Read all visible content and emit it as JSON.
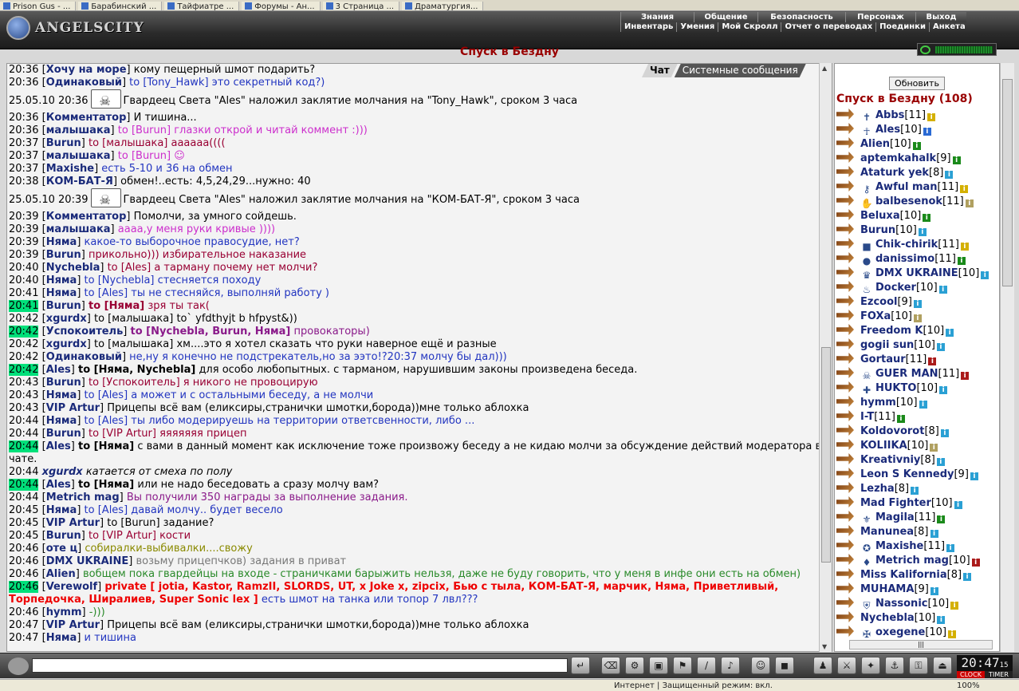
{
  "browser": {
    "tabs": [
      "Prison Gus - ...",
      "Барабинский ...",
      "Тайфиатре ...",
      "Форумы - Ан...",
      "3 Страница ...",
      "Драматургия..."
    ]
  },
  "app": {
    "logo": "ANGELSCITY"
  },
  "menu": {
    "top": [
      "Знания",
      "Общение",
      "Безопасность",
      "Персонаж",
      "Выход"
    ],
    "sub": [
      "Инвентарь",
      "Умения",
      "Мой Скролл",
      "Отчет о переводах",
      "Поединки",
      "Анкета"
    ]
  },
  "room": {
    "title": "Спуск в Бездну",
    "count_label": "Спуск в Бездну (108)",
    "refresh": "Обновить"
  },
  "tabs": {
    "chat": "Чат",
    "system": "Системные сообщения"
  },
  "colors": {
    "hl": "#00e07a",
    "nick": "#1a2a7a",
    "room": "#990000",
    "input_bg": "#ffffff",
    "bar": "#333333"
  },
  "chat": [
    {
      "t": "20:36",
      "nick": "Хочу на море",
      "text": "кому пещерный шмот подарить?",
      "c": "#000"
    },
    {
      "t": "20:36",
      "nick": "Одинаковый",
      "text": "to [Tony_Hawk] это секретный код?)",
      "c": "#2235c0"
    },
    {
      "sys": true,
      "t": "25.05.10 20:36",
      "text": "Гвардеец Света \"Ales\" наложил заклятие молчания на \"Tony_Hawk\", сроком 3 часа"
    },
    {
      "t": "20:36",
      "nick": "Комментатор",
      "text": "И тишина...",
      "c": "#000"
    },
    {
      "t": "20:36",
      "nick": "малышака",
      "text": "to [Burun] глазки открой и читай коммент :)))",
      "c": "#cc2ecc"
    },
    {
      "t": "20:37",
      "nick": "Burun",
      "text": "to [малышака] аааааа((((",
      "c": "#990033"
    },
    {
      "t": "20:37",
      "nick": "малышака",
      "text": "to [Burun] ☺",
      "c": "#cc2ecc"
    },
    {
      "t": "20:37",
      "nick": "Maxishe",
      "text": "есть 5-10 и 36 на обмен",
      "c": "#2235c0"
    },
    {
      "t": "20:38",
      "nick": "КОМ-БАТ-Я",
      "text": "обмен!..есть: 4,5,24,29...нужно: 40",
      "c": "#000"
    },
    {
      "sys": true,
      "t": "25.05.10 20:39",
      "text": "Гвардеец Света \"Ales\" наложил заклятие молчания на \"КОМ-БАТ-Я\", сроком 3 часа"
    },
    {
      "t": "20:39",
      "nick": "Комментатор",
      "text": "Помолчи, за умного сойдешь.",
      "c": "#000"
    },
    {
      "t": "20:39",
      "nick": "малышака",
      "text": "аааа,у меня руки кривые ))))",
      "c": "#cc2ecc"
    },
    {
      "t": "20:39",
      "nick": "Няма",
      "text": "какое-то выборочное правосудие, нет?",
      "c": "#2235c0"
    },
    {
      "t": "20:39",
      "nick": "Burun",
      "text": "прикольно))) избирательное наказание",
      "c": "#990033"
    },
    {
      "t": "20:40",
      "nick": "Nychebla",
      "text": "to [Ales] а тарману почему нет молчи?",
      "c": "#990033"
    },
    {
      "t": "20:40",
      "nick": "Няма",
      "text": "to [Nychebla] стесняется походу",
      "c": "#2235c0"
    },
    {
      "t": "20:41",
      "nick": "Няма",
      "text": "to [Ales] ты не стесняйся, выполняй работу )",
      "c": "#2235c0"
    },
    {
      "t": "20:41",
      "hl": true,
      "nick": "Burun",
      "prefix": "to [Няма]",
      "text": "зря ты так(",
      "c": "#990033"
    },
    {
      "t": "20:42",
      "nick": "xgurdx",
      "text": "to [малышака] to` yfdthyjt b hfpyst&))",
      "c": "#000"
    },
    {
      "t": "20:42",
      "hl": true,
      "nick": "Успокоитель",
      "prefix": "to [Nychebla, Burun, Няма]",
      "text": "провокаторы)",
      "c": "#8a1a8a"
    },
    {
      "t": "20:42",
      "nick": "xgurdx",
      "text": "to [малышака] хм....это я хотел сказать что руки наверное ещё и разные",
      "c": "#000"
    },
    {
      "t": "20:42",
      "nick": "Одинаковый",
      "text": "не,ну я конечно не подстрекатель,но за ээто!?20:37 молчу бы дал)))",
      "c": "#2235c0"
    },
    {
      "t": "20:42",
      "hl": true,
      "nick": "Ales",
      "prefix": "to [Няма, Nychebla]",
      "text": "для особо любопытных. с тарманом, нарушившим законы произведена беседа.",
      "c": "#000"
    },
    {
      "t": "20:43",
      "nick": "Burun",
      "text": "to [Успокоитель] я никого не провоцирую",
      "c": "#990033"
    },
    {
      "t": "20:43",
      "nick": "Няма",
      "text": "to [Ales] а может и с остальными беседу, а не молчи",
      "c": "#2235c0"
    },
    {
      "t": "20:43",
      "nick": "VIP Artur",
      "text": "Прицепы всё вам (еликсиры,странички шмотки,борода))мне только аблохка",
      "c": "#000"
    },
    {
      "t": "20:44",
      "nick": "Няма",
      "text": "to [Ales] ты либо модерируешь на территории ответсвенности, либо ...",
      "c": "#2235c0"
    },
    {
      "t": "20:44",
      "nick": "Burun",
      "text": "to [VIP Artur] яяяяяяя прицеп",
      "c": "#990033"
    },
    {
      "t": "20:44",
      "hl": true,
      "nick": "Ales",
      "prefix": "to [Няма]",
      "text": "с вами в данный момент как исключение тоже произвожу беседу а не кидаю молчи за обсуждение действий модератора в чате.",
      "c": "#000"
    },
    {
      "t": "20:44",
      "emote": "xgurdx",
      "text": "катается от смеха по полу",
      "c": "#000"
    },
    {
      "t": "20:44",
      "hl": true,
      "nick": "Ales",
      "prefix": "to [Няма]",
      "text": "или не надо беседовать а сразу молчу вам?",
      "c": "#000"
    },
    {
      "t": "20:44",
      "nick": "Metrich mag",
      "text": "Вы получили 350 награды за выполнение задания.",
      "c": "#8a1a8a"
    },
    {
      "t": "20:45",
      "nick": "Няма",
      "text": "to [Ales] давай молчу.. будет весело",
      "c": "#2235c0"
    },
    {
      "t": "20:45",
      "nick": "VIP Artur",
      "text": "to [Burun] задание?",
      "c": "#000"
    },
    {
      "t": "20:45",
      "nick": "Burun",
      "text": "to [VIP Artur] кости",
      "c": "#990033"
    },
    {
      "t": "20:46",
      "nick": "оте ц",
      "text": "собиралки-выбивалки....свожу",
      "c": "#8a8a00"
    },
    {
      "t": "20:46",
      "nick": "DMX UKRAINE",
      "text": "возьму прицепчков) задания в приват",
      "c": "#777777"
    },
    {
      "t": "20:46",
      "nick": "Alien",
      "text": "вобщем пока гвардейцы на входе - страничками барыжить нельзя, даже не буду говорить, что у меня в инфе они есть на обмен)",
      "c": "#2a8a2a"
    },
    {
      "t": "20:46",
      "hl": true,
      "nick": "Verewolf",
      "prefix": "private [ jotia, Kastor, RamzII, SLORDS, UT, x Joke x, zipcix, Бью с тыла, КОМ-БАТ-Я, марчик, Няма, Приветливый, Торпедочка, Ширалиев, Super Sonic lex ]",
      "text": "есть шмот на танка или топор 7 лвл???",
      "c": "#2235c0",
      "priv": true
    },
    {
      "t": "20:46",
      "nick": "hymm",
      "text": "-)))",
      "c": "#2a8a2a"
    },
    {
      "t": "20:47",
      "nick": "VIP Artur",
      "text": "Прицепы всё вам (еликсиры,странички шмотки,борода))мне только аблохка",
      "c": "#000"
    },
    {
      "t": "20:47",
      "nick": "Няма",
      "text": "и тишина",
      "c": "#2235c0"
    }
  ],
  "players": [
    {
      "n": "Abbs",
      "l": "[11]",
      "ic": "#d4b000",
      "cl": "✝"
    },
    {
      "n": "Ales",
      "l": "[10]",
      "ic": "#2a6ad4",
      "cl": "☥",
      "noarrowgap": true
    },
    {
      "n": "Alien",
      "l": "[10]",
      "ic": "#1a8a1a"
    },
    {
      "n": "aptemkahalk",
      "l": "[9]",
      "ic": "#1a8a1a"
    },
    {
      "n": "Ataturk yek",
      "l": "[8]",
      "ic": "#2aa0d4"
    },
    {
      "n": "Awful man",
      "l": "[11]",
      "ic": "#d4b000",
      "cl": "⚷"
    },
    {
      "n": "balbesenok",
      "l": "[11]",
      "ic": "#b0a060",
      "cl": "✋"
    },
    {
      "n": "Beluxa",
      "l": "[10]",
      "ic": "#1a8a1a"
    },
    {
      "n": "Burun",
      "l": "[10]",
      "ic": "#2aa0d4"
    },
    {
      "n": "Chik-chirik",
      "l": "[11]",
      "ic": "#d4b000",
      "cl": "■"
    },
    {
      "n": "danissimo",
      "l": "[11]",
      "ic": "#1a8a1a",
      "cl": "●"
    },
    {
      "n": "DMX UKRAINE",
      "l": "[10]",
      "ic": "#2aa0d4",
      "cl": "♛"
    },
    {
      "n": "Docker",
      "l": "[10]",
      "ic": "#2aa0d4",
      "cl": "♨"
    },
    {
      "n": "Ezcool",
      "l": "[9]",
      "ic": "#2aa0d4"
    },
    {
      "n": "FOXa",
      "l": "[10]",
      "ic": "#b0a060"
    },
    {
      "n": "Freedom K",
      "l": "[10]",
      "ic": "#2aa0d4"
    },
    {
      "n": "gogii sun",
      "l": "[10]",
      "ic": "#2aa0d4"
    },
    {
      "n": "Gortaur",
      "l": "[11]",
      "ic": "#aa1a1a"
    },
    {
      "n": "GUER MAN",
      "l": "[11]",
      "ic": "#aa1a1a",
      "cl": "☠"
    },
    {
      "n": "HUKTO",
      "l": "[10]",
      "ic": "#2aa0d4",
      "cl": "✚"
    },
    {
      "n": "hymm",
      "l": "[10]",
      "ic": "#2aa0d4"
    },
    {
      "n": "I-T",
      "l": "[11]",
      "ic": "#1a8a1a"
    },
    {
      "n": "Koldovorot",
      "l": "[8]",
      "ic": "#2aa0d4"
    },
    {
      "n": "KOLIIKA",
      "l": "[10]",
      "ic": "#b0a060"
    },
    {
      "n": "Kreativniy",
      "l": "[8]",
      "ic": "#2aa0d4"
    },
    {
      "n": "Leon S Kennedy",
      "l": "[9]",
      "ic": "#2aa0d4"
    },
    {
      "n": "Lezha",
      "l": "[8]",
      "ic": "#2aa0d4"
    },
    {
      "n": "Mad Fighter",
      "l": "[10]",
      "ic": "#2aa0d4"
    },
    {
      "n": "Magila",
      "l": "[11]",
      "ic": "#1a8a1a",
      "cl": "⚜"
    },
    {
      "n": "Manunea",
      "l": "[8]",
      "ic": "#2aa0d4"
    },
    {
      "n": "Maxishe",
      "l": "[11]",
      "ic": "#2aa0d4",
      "cl": "✪",
      "noarrowgap": true
    },
    {
      "n": "Metrich mag",
      "l": "[10]",
      "ic": "#aa1a1a",
      "cl": "♦"
    },
    {
      "n": "Miss Kalifornia",
      "l": "[8]",
      "ic": "#2aa0d4"
    },
    {
      "n": "MUHAMA",
      "l": "[9]",
      "ic": "#2aa0d4"
    },
    {
      "n": "Nassonic",
      "l": "[10]",
      "ic": "#d4b000",
      "cl": "⛨"
    },
    {
      "n": "Nychebla",
      "l": "[10]",
      "ic": "#2aa0d4"
    },
    {
      "n": "oxegene",
      "l": "[10]",
      "ic": "#d4b000",
      "cl": "✠"
    }
  ],
  "input": {
    "placeholder": ""
  },
  "clock": {
    "time": "20:47",
    "sec": "15",
    "clock_label": "CLOCK",
    "timer_label": "TIMER"
  },
  "status": {
    "text": "Интернет | Защищенный режим: вкл.",
    "zoom": "100%"
  }
}
